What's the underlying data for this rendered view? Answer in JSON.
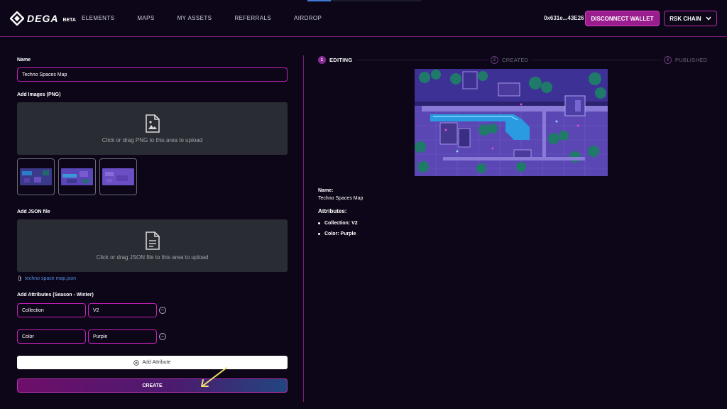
{
  "brand": {
    "logo_text": "DEGA",
    "badge": "BETA"
  },
  "nav": {
    "items": [
      {
        "label": "ELEMENTS"
      },
      {
        "label": "MAPS"
      },
      {
        "label": "MY ASSETS"
      },
      {
        "label": "REFERRALS"
      },
      {
        "label": "AIRDROP"
      }
    ]
  },
  "wallet": {
    "address": "0x631e...43E26",
    "disconnect_label": "DISCONNECT WALLET",
    "chain_label": "RSK CHAIN"
  },
  "form": {
    "name_label": "Name",
    "name_value": "Techno Spaces Map",
    "images_label": "Add Images (PNG)",
    "images_dropzone_text": "Click or drag PNG to this area to upload",
    "json_label": "Add JSON file",
    "json_dropzone_text": "Click or drag JSON file to this area to upload",
    "json_file_name": "techno space map.json",
    "attributes_label": "Add Attributes (Season - Winter)",
    "attributes": [
      {
        "key": "Collection",
        "value": "V2"
      },
      {
        "key": "Color",
        "value": "Purple"
      }
    ],
    "add_attribute_label": "Add Attribute",
    "create_label": "CREATE"
  },
  "steps": [
    {
      "num": "1",
      "label": "EDITING",
      "active": true
    },
    {
      "num": "2",
      "label": "CREATED",
      "active": false
    },
    {
      "num": "3",
      "label": "PUBLISHED",
      "active": false
    }
  ],
  "preview": {
    "name_heading": "Name:",
    "name_value": "Techno Spaces Map",
    "attributes_heading": "Attributes:",
    "attributes": [
      {
        "text": "Collection: V2"
      },
      {
        "text": "Color: Purple"
      }
    ]
  },
  "colors": {
    "background": "#0d0618",
    "accent_magenta": "#c321b8",
    "dropzone": "#2a2c33",
    "link_blue": "#4f8fe0",
    "annotation_arrow": "#f0e070"
  }
}
